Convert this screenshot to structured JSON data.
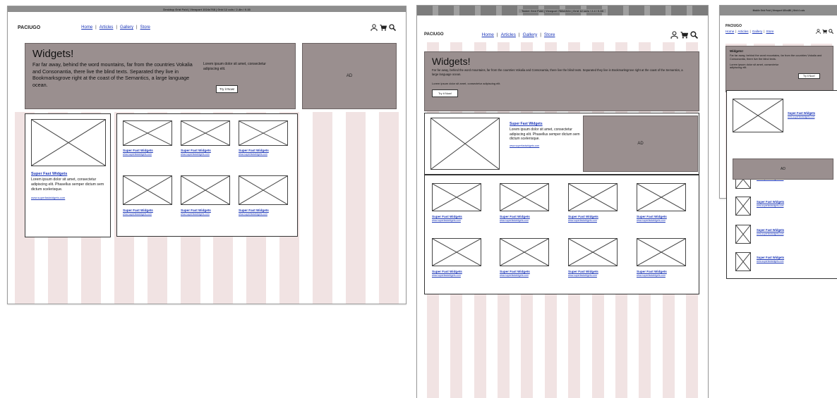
{
  "topbar": {
    "desktop": "Desktop Grid Fold | Viewport 1024x768 | Grid 12 cols / 2.4in / 0.33",
    "tablet": "Tablet Grid Fold | Viewport 768x1024 | Grid 12 cols / 2.4 / 0.33",
    "mobile": "Mobile Grid Fold | Viewport 320x480 | Grid 4 cols"
  },
  "brand": "PACIUGO",
  "nav": [
    "Home",
    "Articles",
    "Gallery",
    "Store"
  ],
  "icons": [
    "user-icon",
    "cart-icon",
    "search-icon"
  ],
  "hero": {
    "title": "Widgets!",
    "body": "Far far away, behind the word mountains, far from the countries Vokalia and Consonantia, there live the blind texts. Separated they live in Bookmarksgrove right at the coast of the Semantics, a large language ocean.",
    "body_short": "Far far away, behind the word mountains, far from the countries Vokalia and Consonantia, there live the blind texts.",
    "aside": "Lorem ipsum dolor sit amet, consectetur adipiscing elit.",
    "button": "Try it Now!"
  },
  "ad_label": "AD",
  "feature": {
    "title": "Super Fast Widgets",
    "body": "Lorem ipsum dolor sit amet, consectetur adipiscing elit. Phasellus semper dictum sem dictum scelerisque.",
    "url": "www.superfastwidgets.com"
  },
  "tile": {
    "title": "Super Fast Widgets",
    "url": "www.superfastwidgets.com"
  },
  "colors": {
    "gray_block": "#9a8f8f",
    "column_pink": "#f1e3e3",
    "link": "#1a35b8"
  }
}
